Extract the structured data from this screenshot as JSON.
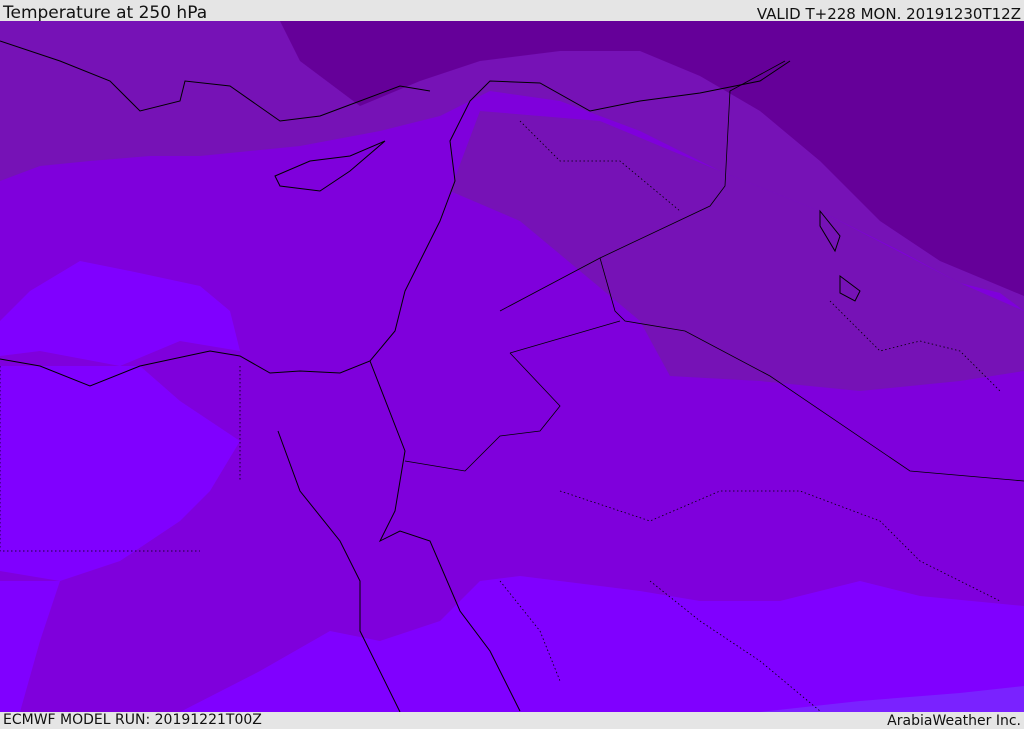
{
  "header": {
    "title": "Temperature at 250 hPa",
    "valid": "VALID T+228 MON. 20191230T12Z"
  },
  "footer": {
    "model_run": "ECMWF MODEL RUN: 20191221T00Z",
    "brand": "ArabiaWeather Inc."
  },
  "colors": {
    "coldest": "#650099",
    "cold": "#7612b6",
    "mid": "#7f00dc",
    "warm": "#8000ff",
    "warmest": "#7a22ff"
  }
}
